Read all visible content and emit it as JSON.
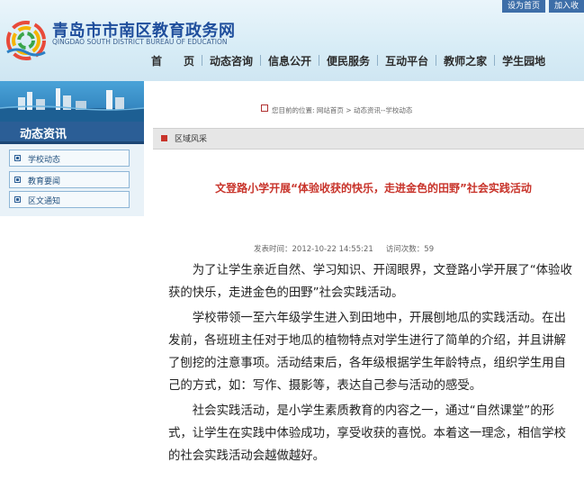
{
  "header": {
    "title": "青岛市市南区教育政务网",
    "subtitle": "QINGDAO SOUTH DISTRICT BUREAU OF EDUCATION",
    "top_links": [
      "设为首页",
      "加入收"
    ]
  },
  "nav": {
    "items": [
      "首　　页",
      "动态咨询",
      "信息公开",
      "便民服务",
      "互动平台",
      "教师之家",
      "学生园地"
    ]
  },
  "sidebar": {
    "title": "动态资讯",
    "items": [
      "学校动态",
      "教育要闻",
      "区文通知"
    ]
  },
  "breadcrumb": {
    "text": "您目前的位置: 网站首页  >  动态资讯--学校动态"
  },
  "section": {
    "title": "区域风采"
  },
  "article": {
    "title": "文登路小学开展“体验收获的快乐，走进金色的田野”社会实践活动",
    "publish": "发表时间：2012-10-22 14:55:21",
    "visits": "访问次数：59",
    "paragraphs": [
      "为了让学生亲近自然、学习知识、开阔眼界，文登路小学开展了“体验收获的快乐，走进金色的田野”社会实践活动。",
      "学校带领一至六年级学生进入到田地中，开展刨地瓜的实践活动。在出发前，各班班主任对于地瓜的植物特点对学生进行了简单的介绍，并且讲解了刨挖的注意事项。活动结束后，各年级根据学生年龄特点，组织学生用自己的方式，如：写作、摄影等，表达自己参与活动的感受。",
      "社会实践活动，是小学生素质教育的内容之一，通过“自然课堂”的形式，让学生在实践中体验成功，享受收获的喜悦。本着这一理念，相信学校的社会实践活动会越做越好。"
    ]
  },
  "colors": {
    "brand_blue": "#2b5e96",
    "title_red": "#c8342b"
  }
}
